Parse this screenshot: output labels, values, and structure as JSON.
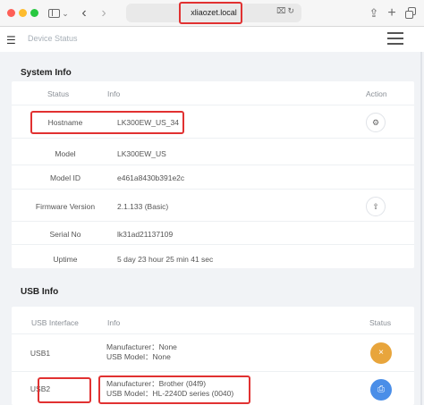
{
  "browser": {
    "url": "xliaozet.local",
    "icons": [
      "sidebar-icon",
      "back-icon",
      "forward-icon",
      "translate-icon",
      "reload-icon",
      "share-icon",
      "new-tab-icon",
      "tab-overview-icon"
    ]
  },
  "header": {
    "title": "Device Status"
  },
  "system_info": {
    "title": "System Info",
    "columns": {
      "status": "Status",
      "info": "Info",
      "action": "Action"
    },
    "rows": [
      {
        "label": "Hostname",
        "value": "LK300EW_US_34",
        "action": "settings"
      },
      {
        "label": "Model",
        "value": "LK300EW_US"
      },
      {
        "label": "Model ID",
        "value": "e461a8430b391e2c"
      },
      {
        "label": "Firmware Version",
        "value": "2.1.133 (Basic)",
        "action": "upload"
      },
      {
        "label": "Serial No",
        "value": "lk31ad21137109"
      },
      {
        "label": "Uptime",
        "value": "5 day 23 hour 25 min 41 sec"
      }
    ]
  },
  "usb_info": {
    "title": "USB Info",
    "columns": {
      "interface": "USB Interface",
      "info": "Info",
      "status": "Status"
    },
    "rows": [
      {
        "label": "USB1",
        "manufacturer": "Manufacturer：None",
        "model": "USB Model：None",
        "status_color": "#e8a53c"
      },
      {
        "label": "USB2",
        "manufacturer": "Manufacturer：Brother (04f9)",
        "model": "USB Model：HL-2240D series (0040)",
        "status_color": "#4a8ee8"
      }
    ]
  },
  "colors": {
    "highlight": "#e13131",
    "background": "#f1f3f6"
  }
}
